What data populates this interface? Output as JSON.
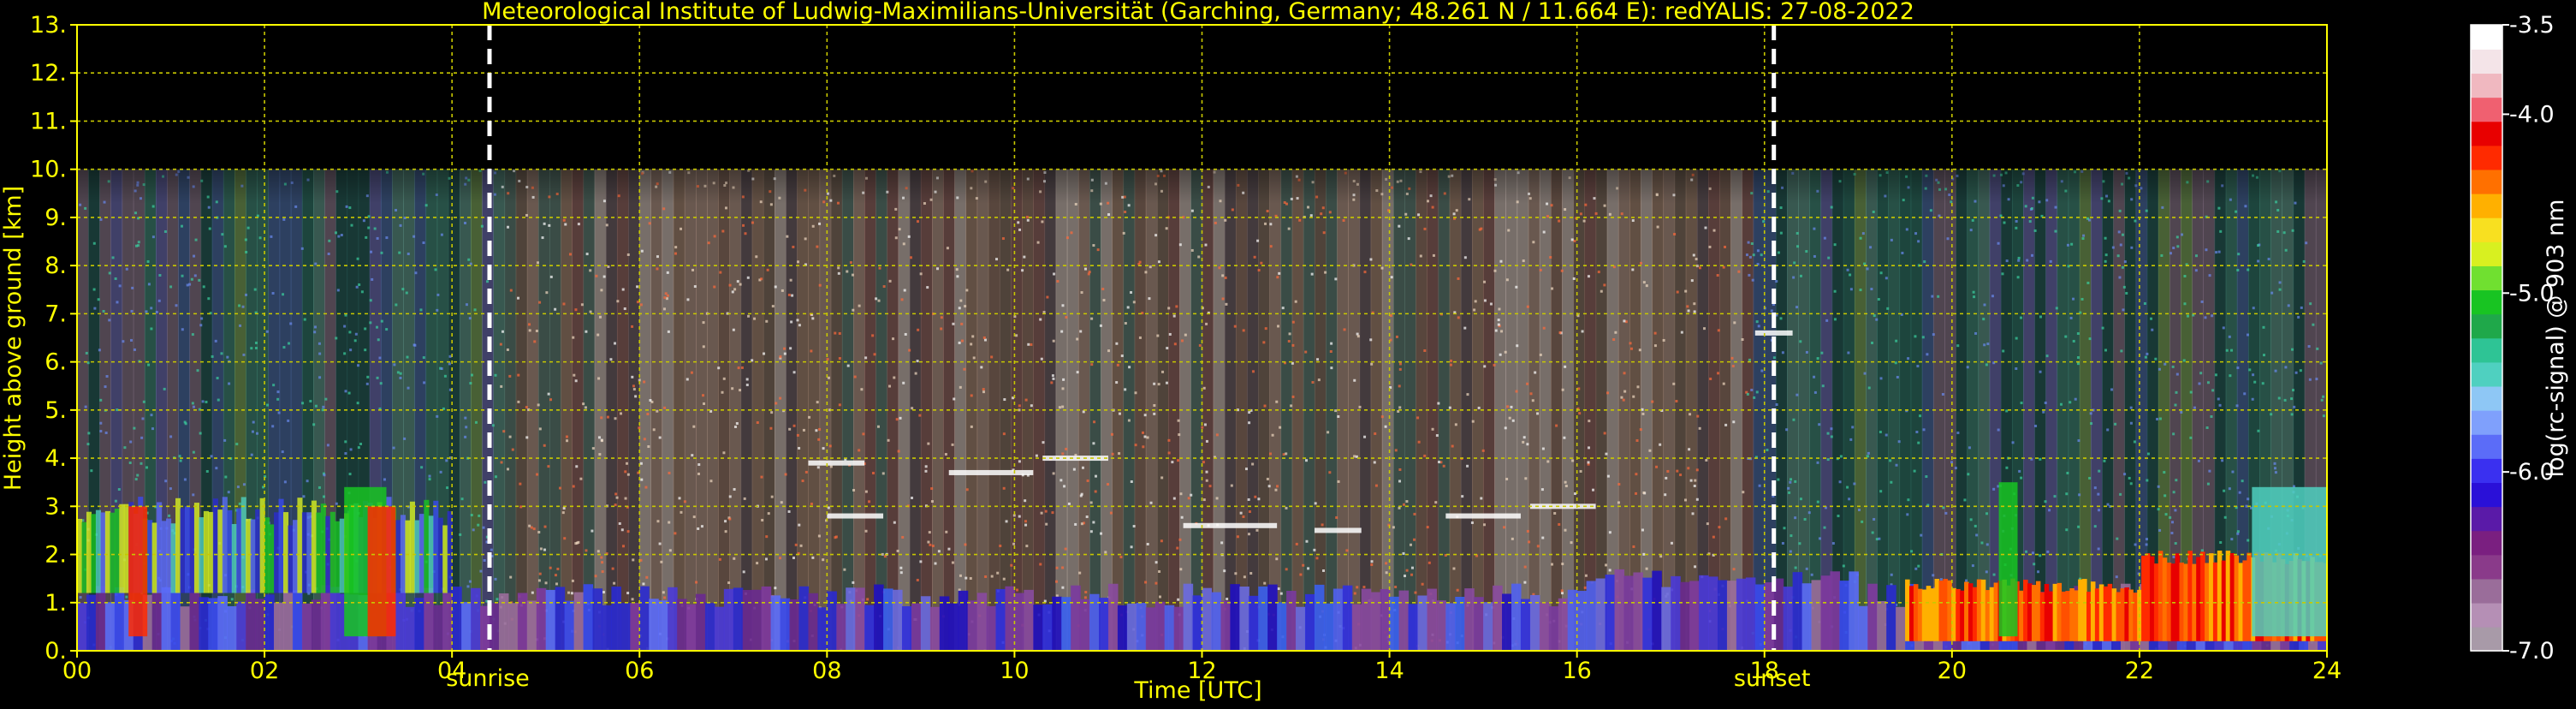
{
  "chart_data": {
    "type": "heatmap",
    "title": "Meteorological Institute of Ludwig-Maximilians-Universität (Garching, Germany; 48.261 N / 11.664 E):    redYALIS: 27-08-2022",
    "xlabel": "Time [UTC]",
    "ylabel": "Height above ground [km]",
    "xlim": [
      0,
      24
    ],
    "ylim": [
      0,
      13
    ],
    "x_tick_labels": [
      "00",
      "02",
      "04",
      "06",
      "08",
      "10",
      "12",
      "14",
      "16",
      "18",
      "20",
      "22",
      "24"
    ],
    "y_tick_labels": [
      "0.",
      "1.",
      "2.",
      "3.",
      "4.",
      "5.",
      "6.",
      "7.",
      "8.",
      "9.",
      "10.",
      "11.",
      "12.",
      "13."
    ],
    "grid": true,
    "data_max_height_km": 10,
    "colorbar": {
      "label": "log(rc-signal) @ 903 nm",
      "range": [
        -7.0,
        -3.5
      ],
      "tick_labels": [
        "-3.5",
        "-4.0",
        "-5.0",
        "-6.0",
        "-7.0"
      ],
      "ticks": [
        -3.5,
        -4.0,
        -5.0,
        -6.0,
        -7.0
      ],
      "colors": [
        "#a89aa8",
        "#b58fb5",
        "#9a6d9a",
        "#8a3a8a",
        "#7a1f80",
        "#5a1aa8",
        "#2a10d8",
        "#3a30f0",
        "#5b6cf8",
        "#7fa0fc",
        "#8ec7f5",
        "#4fd0c0",
        "#2ec495",
        "#1fa84a",
        "#18c422",
        "#70e030",
        "#d8f020",
        "#f8e020",
        "#ffb000",
        "#ff7000",
        "#ff2a00",
        "#e80000",
        "#f06070",
        "#f0b8c0",
        "#f4e4e8",
        "#ffffff"
      ]
    },
    "annotations": [
      {
        "text": "sunrise",
        "x": 4.4
      },
      {
        "text": "sunset",
        "x": 18.1
      }
    ],
    "colors": {
      "axis": "#ffff00",
      "grid": "#c8c800",
      "background": "#000000",
      "marker": "#ffffff"
    }
  }
}
